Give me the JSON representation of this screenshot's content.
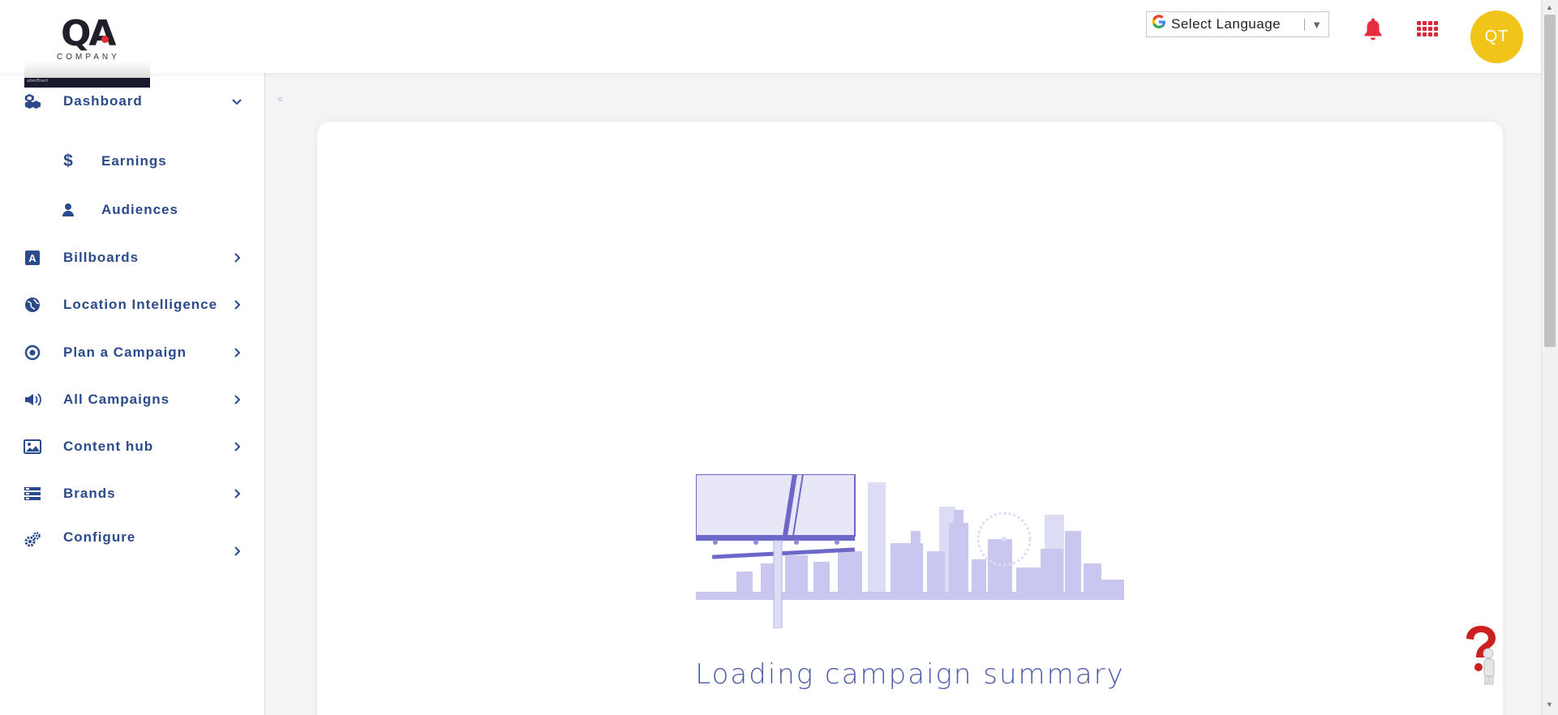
{
  "header": {
    "logo_mark": "QA",
    "logo_sub": "COMPANY",
    "logo_bar_text": "adverBoard",
    "language": {
      "icon": "google-g-icon",
      "label": "Select Language",
      "arrow": "▼"
    },
    "notifications_icon": "bell-icon",
    "apps_icon": "grid-apps-icon",
    "avatar_initials": "QT"
  },
  "sidebar": {
    "items": [
      {
        "label": "Dashboard",
        "icon": "dashboard-icon",
        "chevron": "down"
      },
      {
        "label": "Earnings",
        "icon": "dollar-icon"
      },
      {
        "label": "Audiences",
        "icon": "user-icon"
      },
      {
        "label": "Billboards",
        "icon": "billboard-a-icon",
        "chevron": "right"
      },
      {
        "label": "Location Intelligence",
        "icon": "globe-icon",
        "chevron": "right"
      },
      {
        "label": "Plan a Campaign",
        "icon": "target-icon",
        "chevron": "right"
      },
      {
        "label": "All Campaigns",
        "icon": "megaphone-icon",
        "chevron": "right"
      },
      {
        "label": "Content hub",
        "icon": "image-icon",
        "chevron": "right"
      },
      {
        "label": "Brands",
        "icon": "brands-list-icon",
        "chevron": "right"
      },
      {
        "label": "Configure",
        "icon": "gears-icon",
        "chevron": "right"
      }
    ]
  },
  "main": {
    "loading_text": "Loading campaign summary",
    "illustration": "billboard-city-illustration"
  },
  "colors": {
    "nav_text": "#2b4a8b",
    "accent_red": "#d42b3c",
    "avatar_bg": "#f0c419",
    "loading_text": "#4a5aa8",
    "illustration": "#c9c7f0"
  }
}
